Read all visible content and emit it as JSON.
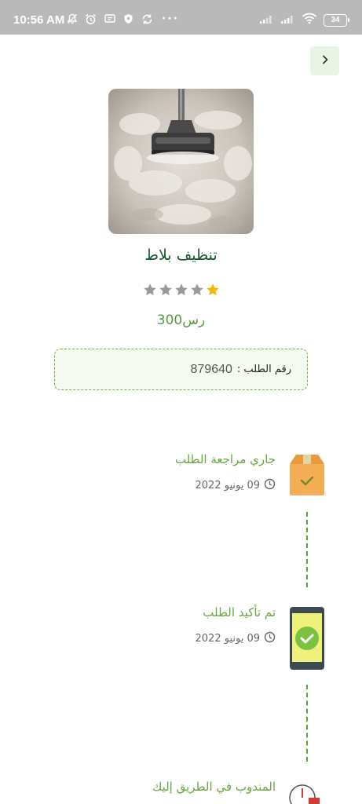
{
  "status_bar": {
    "time": "10:56 AM",
    "battery": "34",
    "more": "···",
    "icons_left": [
      "notifications-off-icon",
      "alarm-icon",
      "message-icon",
      "shield-icon",
      "sync-icon"
    ],
    "icons_right": [
      "signal-icon",
      "signal-icon",
      "wifi-icon",
      "battery-icon"
    ]
  },
  "header": {
    "back_icon": "chevron-right-icon"
  },
  "service": {
    "title": "تنظيف بلاط",
    "rating": 1,
    "rating_max": 5,
    "price": "300رس",
    "image": "vacuum-cleaner-on-carpet"
  },
  "order": {
    "label": "رقم الطلب :",
    "number": "879640"
  },
  "timeline": [
    {
      "title": "جاري مراجعة الطلب",
      "date": "09 يونيو 2022",
      "icon": "package-check-icon"
    },
    {
      "title": "تم تأكيد الطلب",
      "date": "09 يونيو 2022",
      "icon": "phone-check-icon"
    },
    {
      "title": "المندوب في الطريق إليك",
      "date": "",
      "icon": "delivery-clock-icon"
    }
  ],
  "colors": {
    "accent_green": "#66a840",
    "title_dark_green": "#1a5530",
    "star_gold": "#f5b800",
    "star_gray": "#9a9a9a",
    "status_bar": "#b9b9b9"
  }
}
